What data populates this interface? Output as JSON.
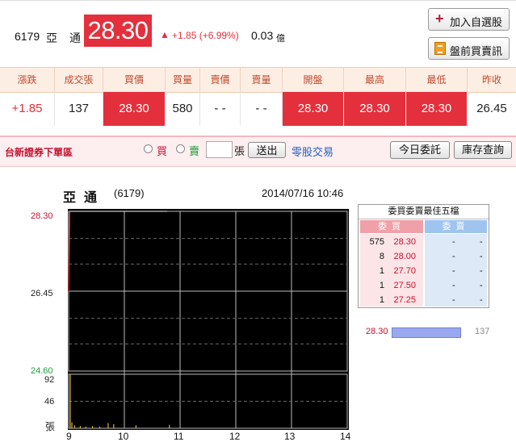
{
  "header": {
    "code": "6179",
    "name_char1": "亞",
    "name_char2": "通",
    "price": "28.30",
    "up_arrow": "▲",
    "change": "+1.85 (+6.99%)",
    "volume": "0.03",
    "volume_unit": "億",
    "add_watchlist_label": "加入自選股",
    "add_icon": "plus-icon",
    "premarket_label": "盤前買賣訊",
    "premarket_icon": "document-icon"
  },
  "quote_table": {
    "headers": [
      "漲跌",
      "成交張",
      "買價",
      "買量",
      "賣價",
      "賣量",
      "開盤",
      "最高",
      "最低",
      "昨收"
    ],
    "values": [
      "+1.85",
      "137",
      "28.30",
      "580",
      "- -",
      "- -",
      "28.30",
      "28.30",
      "28.30",
      "26.45"
    ]
  },
  "order_bar": {
    "title": "台新證券下單區",
    "buy": "買",
    "sell": "賣",
    "qty_value": "",
    "unit": "張",
    "send": "送出",
    "odd_lot": "零股交易",
    "today_orders": "今日委託",
    "inventory": "庫存查詢"
  },
  "chart_header": {
    "name": "亞通",
    "code": "(6179)",
    "datetime": "2014/07/16 10:46"
  },
  "colors": {
    "up": "#e3303c",
    "down": "#1e9e3a",
    "price_line": "#c8c8c8",
    "volume_bar": "#d8b040"
  },
  "chart_data": {
    "type": "line",
    "title": "",
    "xlabel": "",
    "ylabel": "",
    "x_ticks": [
      "9",
      "10",
      "11",
      "12",
      "13",
      "14"
    ],
    "y_ticks_price": [
      "28.30",
      "26.45",
      "24.60"
    ],
    "price_ylim": [
      24.6,
      28.3
    ],
    "volume_ticks": [
      "92",
      "46",
      "張"
    ],
    "volume_ylim": [
      0,
      92
    ],
    "grid": true,
    "series": [
      {
        "x": [
          9.0,
          9.02,
          9.5,
          10.0,
          10.5,
          10.77
        ],
        "values": [
          26.45,
          28.3,
          28.3,
          28.3,
          28.3,
          28.3
        ]
      }
    ],
    "volume": {
      "x": [
        9.02,
        9.05,
        9.1,
        9.2,
        9.3,
        9.42,
        9.55,
        9.7,
        9.8,
        10.2,
        10.8
      ],
      "values": [
        92,
        10,
        5,
        4,
        3,
        4,
        3,
        9,
        7,
        5,
        6
      ]
    }
  },
  "five_levels": {
    "title": "委買委賣最佳五檔",
    "bid_header": "委買",
    "ask_header": "委賣",
    "rows": [
      {
        "bid_vol": "575",
        "bid_price": "28.30",
        "ask_price": "-",
        "ask_vol": "-"
      },
      {
        "bid_vol": "8",
        "bid_price": "28.00",
        "ask_price": "-",
        "ask_vol": "-"
      },
      {
        "bid_vol": "1",
        "bid_price": "27.70",
        "ask_price": "-",
        "ask_vol": "-"
      },
      {
        "bid_vol": "1",
        "bid_price": "27.50",
        "ask_price": "-",
        "ask_vol": "-"
      },
      {
        "bid_vol": "1",
        "bid_price": "27.25",
        "ask_price": "-",
        "ask_vol": "-"
      }
    ]
  },
  "trade_distribution": {
    "price": "28.30",
    "volume": "137",
    "share": 1.0
  }
}
